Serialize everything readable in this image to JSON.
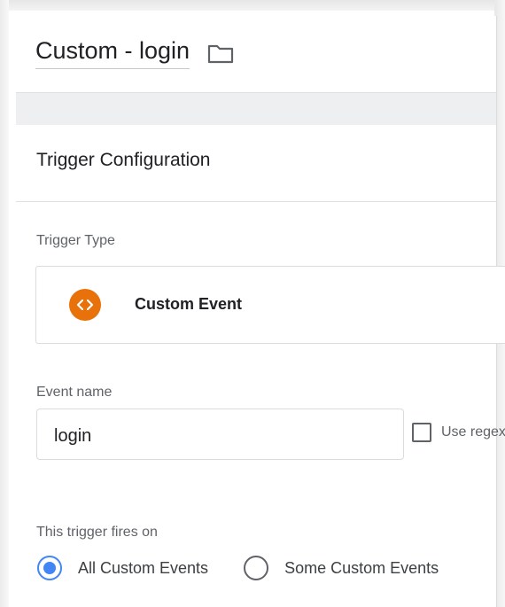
{
  "header": {
    "title": "Custom - login",
    "folder_icon": "folder-icon"
  },
  "trigger_config": {
    "section_title": "Trigger Configuration",
    "trigger_type_label": "Trigger Type",
    "trigger_type": {
      "name": "Custom Event",
      "icon": "code-brackets-icon",
      "icon_color": "#e8710a"
    },
    "event_name_label": "Event name",
    "event_name_value": "login",
    "use_regex_label": "Use regex matching",
    "use_regex_checked": false,
    "fires_on_label": "This trigger fires on",
    "fires_on_options": [
      {
        "label": "All Custom Events",
        "selected": true
      },
      {
        "label": "Some Custom Events",
        "selected": false
      }
    ]
  },
  "colors": {
    "accent": "#4285f4",
    "trigger_icon": "#e8710a",
    "text": "#202124",
    "secondary_text": "#5f6368"
  }
}
